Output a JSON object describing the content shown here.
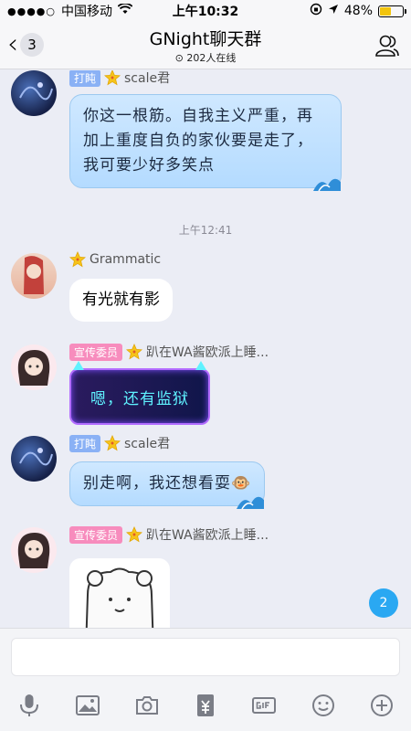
{
  "status_bar": {
    "signal": "●●●●○",
    "carrier": "中国移动",
    "time": "上午10:32",
    "battery_text": "48%",
    "battery_level": 0.48
  },
  "header": {
    "back_count": "3",
    "title": "GNight聊天群",
    "online": "202人在线"
  },
  "messages": [
    {
      "badge": "打盹",
      "name": "scale君",
      "text": "你这一根筋。自我主义严重，再加上重度自负的家伙要是走了，我可要少好多笑点"
    },
    {
      "timestamp": "上午12:41"
    },
    {
      "name": "Grammatic",
      "text": "有光就有影"
    },
    {
      "badge": "宣传委员",
      "name": "趴在WA酱欧派上睡...",
      "text": "嗯，还有监狱"
    },
    {
      "badge": "打盹",
      "name": "scale君",
      "text": "别走啊，我还想看耍🐵"
    },
    {
      "badge": "宣传委员",
      "name": "趴在WA酱欧派上睡..."
    }
  ],
  "unread_count": "2",
  "colors": {
    "accent": "#2aa8f2",
    "badge_blue": "#8ab1f5",
    "badge_pink": "#f78cbd"
  }
}
